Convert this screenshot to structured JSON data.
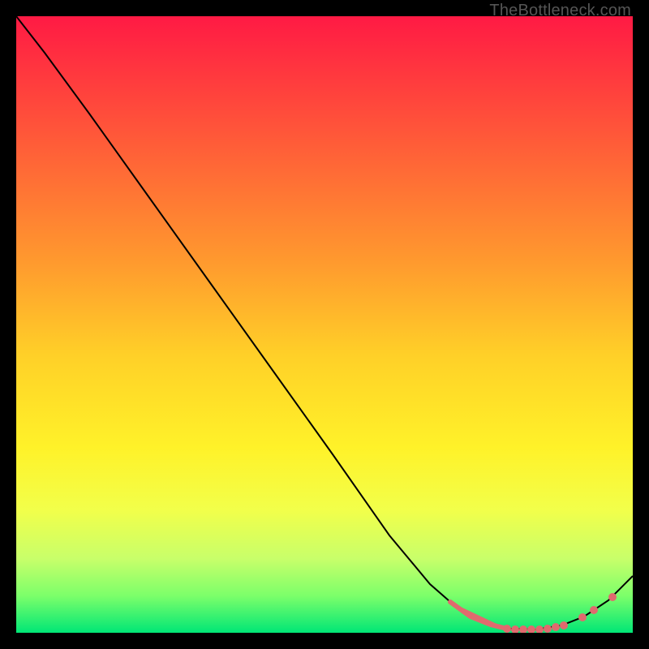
{
  "watermark": "TheBottleneck.com",
  "chart_data": {
    "type": "line",
    "title": "",
    "xlabel": "",
    "ylabel": "",
    "xlim": [
      0,
      100
    ],
    "ylim": [
      0,
      100
    ],
    "series": [
      {
        "name": "bottleneck-curve",
        "x": [
          0,
          5,
          10,
          20,
          30,
          40,
          50,
          60,
          67,
          72,
          76,
          80,
          84,
          88,
          92,
          96,
          100
        ],
        "y": [
          100,
          94,
          88,
          76,
          63,
          50,
          37,
          24,
          13,
          6,
          2,
          0,
          0,
          0,
          2,
          6,
          12
        ]
      }
    ],
    "markers": {
      "name": "optimal-range",
      "x": [
        72,
        74,
        76,
        78,
        80,
        82,
        84,
        86,
        88,
        90,
        92,
        94
      ],
      "y": [
        6,
        4,
        2,
        1,
        0,
        0,
        0,
        0,
        0,
        1,
        2,
        5
      ]
    },
    "colors": {
      "curve": "#000000",
      "markers": "#e06a6e",
      "gradient_top": "#ff1a44",
      "gradient_mid": "#fff229",
      "gradient_bottom": "#00e676"
    }
  }
}
